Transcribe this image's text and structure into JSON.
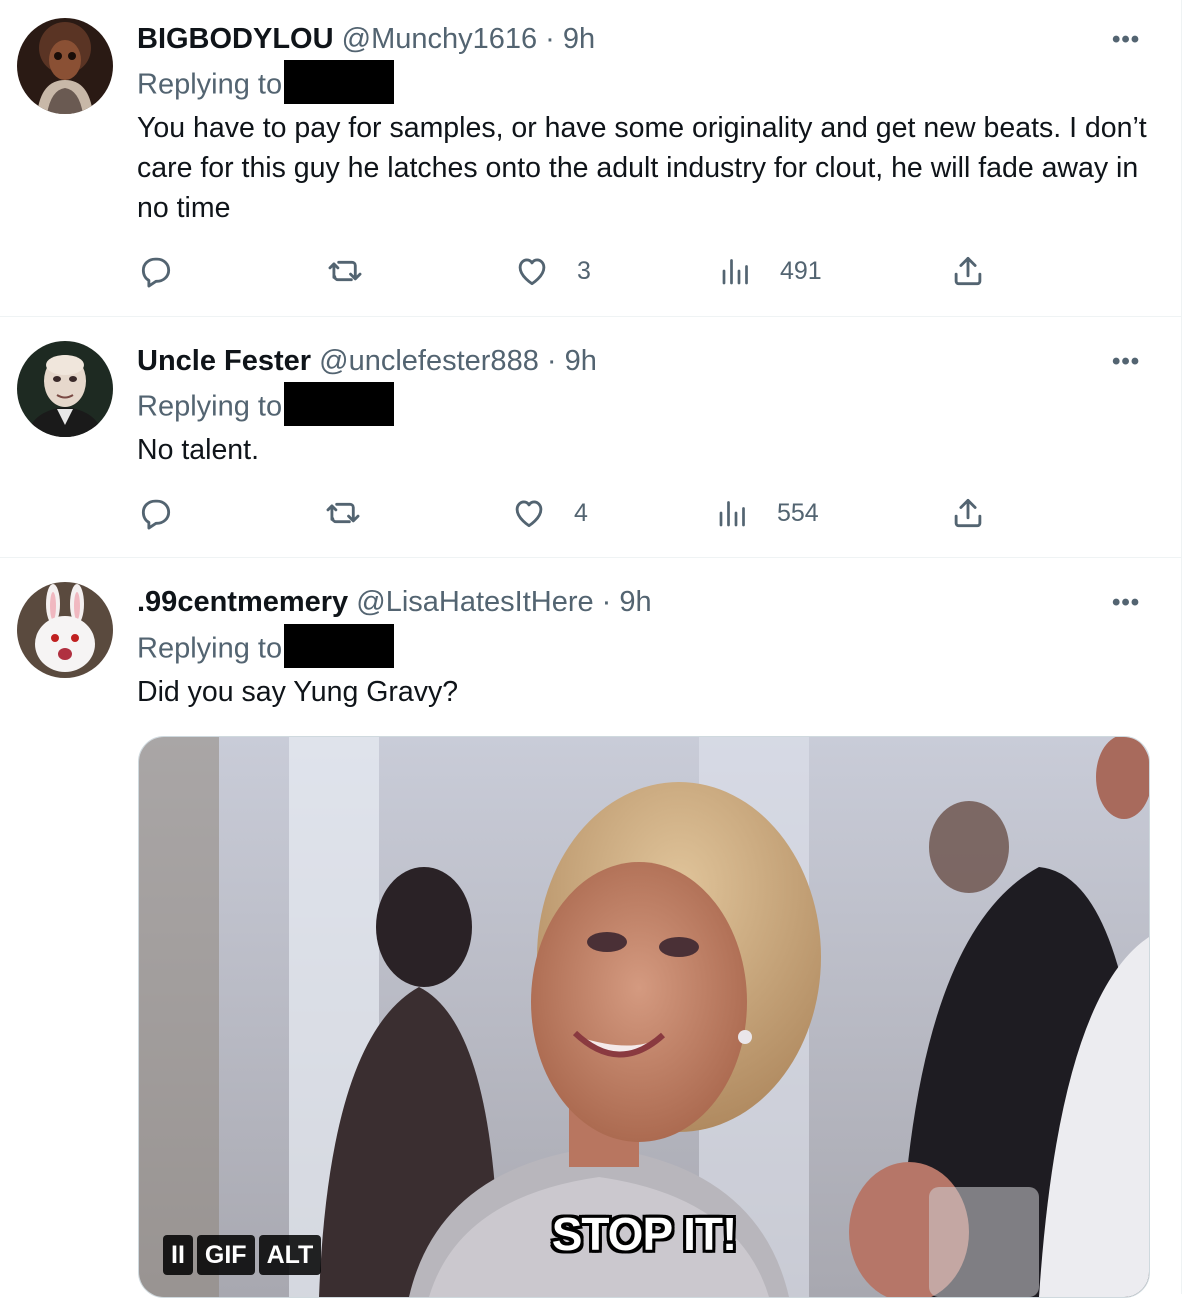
{
  "tweets": [
    {
      "name": "BIGBODYLOU",
      "handle": "@Munchy1616",
      "dot": " · ",
      "time": "9h",
      "replying": "Replying to",
      "text": "You have to pay for samples, or have some originality and get new beats. I don’t care for this guy he latches onto the adult industry for clout, he will fade away in no time",
      "likes": "3",
      "views": "491"
    },
    {
      "name": "Uncle Fester",
      "handle": "@unclefester888",
      "dot": " · ",
      "time": "9h",
      "replying": "Replying to",
      "text": "No talent.",
      "likes": "4",
      "views": "554"
    },
    {
      "name": ".99centmemery",
      "handle": "@LisaHatesItHere",
      "dot": " · ",
      "time": "9h",
      "replying": "Replying to",
      "text": "Did you say Yung Gravy?",
      "media": {
        "caption": "STOP IT!",
        "badges": [
          "II",
          "GIF",
          "ALT"
        ]
      }
    }
  ],
  "more_label": "•••",
  "colors": {
    "text_primary": "#0f1419",
    "text_secondary": "#536471",
    "divider": "#eff3f4"
  },
  "icons": [
    "reply-icon",
    "retweet-icon",
    "like-icon",
    "views-icon",
    "share-icon",
    "more-icon"
  ]
}
